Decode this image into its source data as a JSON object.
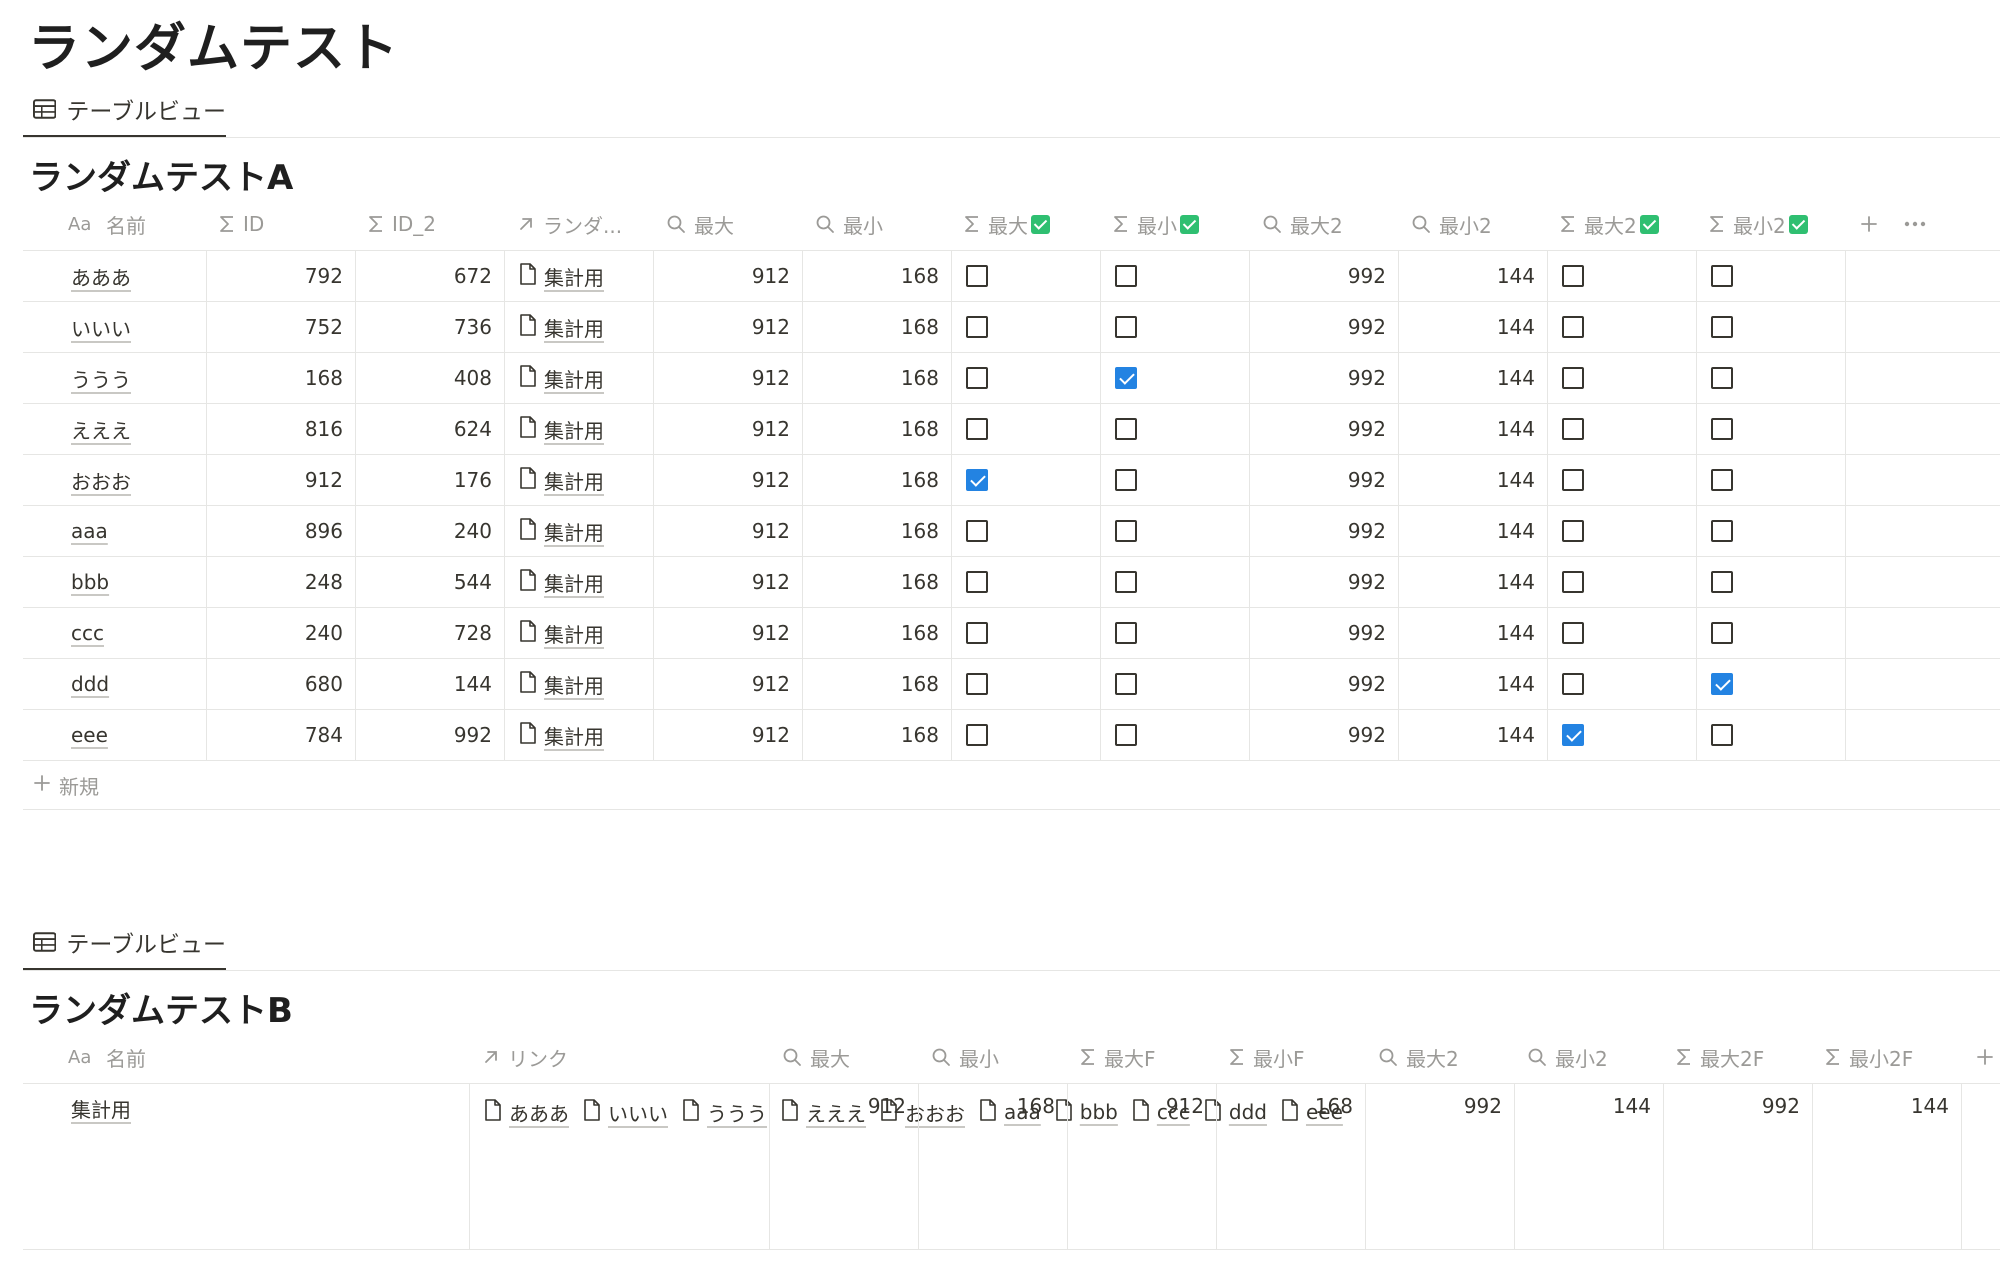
{
  "page": {
    "title": "ランダムテスト"
  },
  "colors": {
    "accent": "#2383e2",
    "prop_ok": "#2fbf71",
    "border": "#e6e6e4",
    "header_text": "#9b9a97"
  },
  "table_a": {
    "view_tab": {
      "icon": "table-icon",
      "label": "テーブルビュー"
    },
    "title": "ランダムテストA",
    "columns": [
      {
        "icon": "text-icon",
        "label": "名前"
      },
      {
        "icon": "sigma-icon",
        "label": "ID"
      },
      {
        "icon": "sigma-icon",
        "label": "ID_2"
      },
      {
        "icon": "arrow-up-right-icon",
        "label": "ランダ..."
      },
      {
        "icon": "search-icon",
        "label": "最大"
      },
      {
        "icon": "search-icon",
        "label": "最小"
      },
      {
        "icon": "sigma-icon",
        "label": "最大",
        "badge": "check-badge-icon"
      },
      {
        "icon": "sigma-icon",
        "label": "最小",
        "badge": "check-badge-icon"
      },
      {
        "icon": "search-icon",
        "label": "最大2"
      },
      {
        "icon": "search-icon",
        "label": "最小2"
      },
      {
        "icon": "sigma-icon",
        "label": "最大2",
        "badge": "check-badge-icon"
      },
      {
        "icon": "sigma-icon",
        "label": "最小2",
        "badge": "check-badge-icon"
      }
    ],
    "add_column_icon": "plus-icon",
    "more_icon": "more-icon",
    "rows": [
      {
        "name": "あああ",
        "id": "792",
        "id2": "672",
        "relation": "集計用",
        "max": "912",
        "min": "168",
        "is_max": false,
        "is_min": false,
        "max2": "992",
        "min2": "144",
        "is_max2": false,
        "is_min2": false
      },
      {
        "name": "いいい",
        "id": "752",
        "id2": "736",
        "relation": "集計用",
        "max": "912",
        "min": "168",
        "is_max": false,
        "is_min": false,
        "max2": "992",
        "min2": "144",
        "is_max2": false,
        "is_min2": false
      },
      {
        "name": "ううう",
        "id": "168",
        "id2": "408",
        "relation": "集計用",
        "max": "912",
        "min": "168",
        "is_max": false,
        "is_min": true,
        "max2": "992",
        "min2": "144",
        "is_max2": false,
        "is_min2": false
      },
      {
        "name": "えええ",
        "id": "816",
        "id2": "624",
        "relation": "集計用",
        "max": "912",
        "min": "168",
        "is_max": false,
        "is_min": false,
        "max2": "992",
        "min2": "144",
        "is_max2": false,
        "is_min2": false
      },
      {
        "name": "おおお",
        "id": "912",
        "id2": "176",
        "relation": "集計用",
        "max": "912",
        "min": "168",
        "is_max": true,
        "is_min": false,
        "max2": "992",
        "min2": "144",
        "is_max2": false,
        "is_min2": false
      },
      {
        "name": "aaa",
        "id": "896",
        "id2": "240",
        "relation": "集計用",
        "max": "912",
        "min": "168",
        "is_max": false,
        "is_min": false,
        "max2": "992",
        "min2": "144",
        "is_max2": false,
        "is_min2": false
      },
      {
        "name": "bbb",
        "id": "248",
        "id2": "544",
        "relation": "集計用",
        "max": "912",
        "min": "168",
        "is_max": false,
        "is_min": false,
        "max2": "992",
        "min2": "144",
        "is_max2": false,
        "is_min2": false
      },
      {
        "name": "ccc",
        "id": "240",
        "id2": "728",
        "relation": "集計用",
        "max": "912",
        "min": "168",
        "is_max": false,
        "is_min": false,
        "max2": "992",
        "min2": "144",
        "is_max2": false,
        "is_min2": false
      },
      {
        "name": "ddd",
        "id": "680",
        "id2": "144",
        "relation": "集計用",
        "max": "912",
        "min": "168",
        "is_max": false,
        "is_min": false,
        "max2": "992",
        "min2": "144",
        "is_max2": false,
        "is_min2": true
      },
      {
        "name": "eee",
        "id": "784",
        "id2": "992",
        "relation": "集計用",
        "max": "912",
        "min": "168",
        "is_max": false,
        "is_min": false,
        "max2": "992",
        "min2": "144",
        "is_max2": true,
        "is_min2": false
      }
    ],
    "new_row": {
      "icon": "plus-icon",
      "label": "新規"
    }
  },
  "table_b": {
    "view_tab": {
      "icon": "table-icon",
      "label": "テーブルビュー"
    },
    "title": "ランダムテストB",
    "columns": [
      {
        "icon": "text-icon",
        "label": "名前"
      },
      {
        "icon": "arrow-up-right-icon",
        "label": "リンク"
      },
      {
        "icon": "search-icon",
        "label": "最大"
      },
      {
        "icon": "search-icon",
        "label": "最小"
      },
      {
        "icon": "sigma-icon",
        "label": "最大F"
      },
      {
        "icon": "sigma-icon",
        "label": "最小F"
      },
      {
        "icon": "search-icon",
        "label": "最大2"
      },
      {
        "icon": "search-icon",
        "label": "最小2"
      },
      {
        "icon": "sigma-icon",
        "label": "最大2F"
      },
      {
        "icon": "sigma-icon",
        "label": "最小2F"
      }
    ],
    "add_column_icon": "plus-icon",
    "rows": [
      {
        "name": "集計用",
        "links": [
          "あああ",
          "いいい",
          "ううう",
          "えええ",
          "おおお",
          "aaa",
          "bbb",
          "ccc",
          "ddd",
          "eee"
        ],
        "values": [
          "912",
          "168",
          "912",
          "168",
          "992",
          "144",
          "992",
          "144"
        ]
      }
    ]
  }
}
